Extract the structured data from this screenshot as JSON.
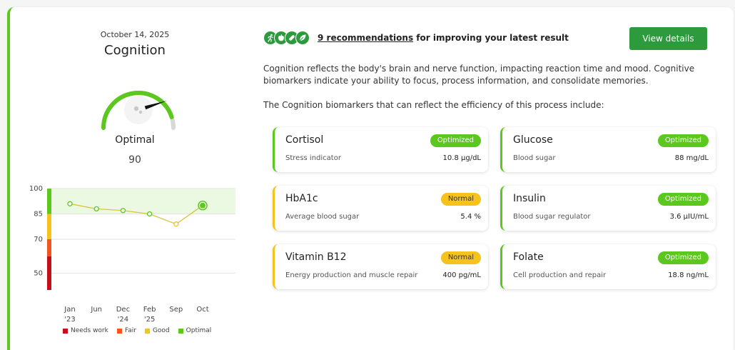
{
  "summary": {
    "date": "October 14, 2025",
    "title": "Cognition",
    "status": "Optimal",
    "score": "90"
  },
  "gauge": {
    "value_fraction": 0.9
  },
  "colors": {
    "optimal": "#5cc71c",
    "good": "#f6c21c",
    "fair": "#f0561d",
    "needs_work": "#c2101f",
    "brand": "#2e9a3e"
  },
  "chart_data": {
    "type": "line",
    "x": [
      "Jan '23",
      "Jun",
      "Dec '24",
      "Feb '25",
      "Sep",
      "Oct"
    ],
    "tick_labels": [
      [
        "Jan",
        "'23"
      ],
      [
        "Jun",
        ""
      ],
      [
        "Dec",
        "'24"
      ],
      [
        "Feb",
        "'25"
      ],
      [
        "Sep",
        ""
      ],
      [
        "Oct",
        ""
      ]
    ],
    "values": [
      91,
      88,
      87,
      85,
      79,
      90
    ],
    "y_ticks": [
      100,
      85,
      70,
      50
    ],
    "ylim": [
      40,
      100
    ],
    "optimal_band": [
      85,
      100
    ],
    "bands": [
      {
        "label": "Needs work",
        "range": [
          40,
          60
        ]
      },
      {
        "label": "Fair",
        "range": [
          60,
          70
        ]
      },
      {
        "label": "Good",
        "range": [
          70,
          85
        ]
      },
      {
        "label": "Optimal",
        "range": [
          85,
          100
        ]
      }
    ]
  },
  "legend": [
    {
      "label": "Needs work",
      "color": "#c2101f"
    },
    {
      "label": "Fair",
      "color": "#f0561d"
    },
    {
      "label": "Good",
      "color": "#f6c21c"
    },
    {
      "label": "Optimal",
      "color": "#5cc71c"
    }
  ],
  "recommendations": {
    "icons": [
      "running-icon",
      "apple-icon",
      "pill-icon",
      "leaf-icon"
    ],
    "link_text": "9 recommendations",
    "suffix": " for improving your latest result",
    "button": "View details"
  },
  "description": "Cognition reflects the body's brain and nerve function, impacting reaction time and mood. Cognitive biomarkers indicate your ability to focus, process information, and consolidate memories.",
  "intro": "The Cognition biomarkers that can reflect the efficiency of this process include:",
  "biomarkers": [
    {
      "name": "Cortisol",
      "status": "Optimized",
      "desc": "Stress indicator",
      "value": "10.8 μg/dL"
    },
    {
      "name": "Glucose",
      "status": "Optimized",
      "desc": "Blood sugar",
      "value": "88 mg/dL"
    },
    {
      "name": "HbA1c",
      "status": "Normal",
      "desc": "Average blood sugar",
      "value": "5.4 %"
    },
    {
      "name": "Insulin",
      "status": "Optimized",
      "desc": "Blood sugar regulator",
      "value": "3.6 μIU/mL"
    },
    {
      "name": "Vitamin B12",
      "status": "Normal",
      "desc": "Energy production and muscle repair",
      "value": "400 pg/mL"
    },
    {
      "name": "Folate",
      "status": "Optimized",
      "desc": "Cell production and repair",
      "value": "18.8 ng/mL"
    }
  ]
}
